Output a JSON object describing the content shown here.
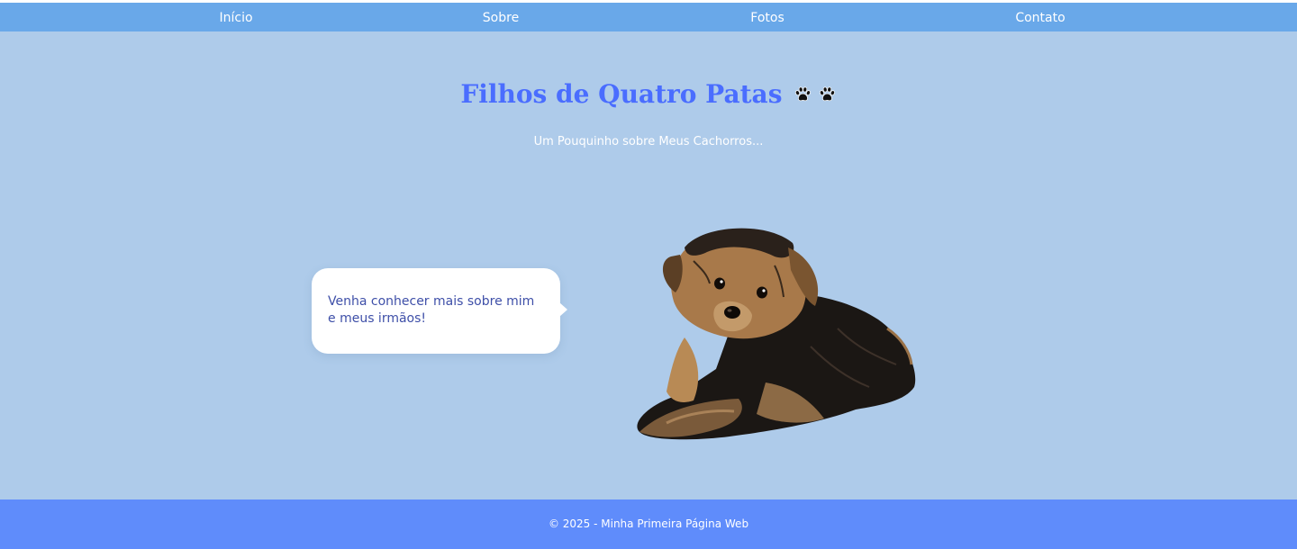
{
  "nav": {
    "items": [
      {
        "label": "Início"
      },
      {
        "label": "Sobre"
      },
      {
        "label": "Fotos"
      },
      {
        "label": "Contato"
      }
    ]
  },
  "header": {
    "title": "Filhos de Quatro Patas",
    "title_icons": [
      "paw-icon",
      "paw-icon"
    ],
    "subtitle": "Um Pouquinho sobre Meus Cachorros..."
  },
  "main": {
    "speech_bubble": "Venha conhecer mais sobre mim e meus irmãos!",
    "image": "yorkshire-puppy"
  },
  "footer": {
    "text": "© 2025 - Minha Primeira Página Web"
  },
  "colors": {
    "background": "#aecbea",
    "navbar": "#69a8e9",
    "title": "#4a6dff",
    "footer": "#5f8cfb"
  }
}
